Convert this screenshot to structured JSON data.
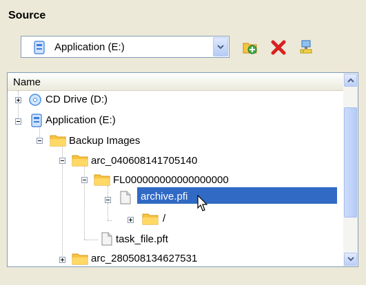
{
  "section": {
    "title": "Source"
  },
  "source_select": {
    "value": "Application (E:)"
  },
  "toolbar": {
    "add_icon": "folder-add-icon",
    "delete_icon": "delete-x-icon",
    "network_icon": "network-computer-icon"
  },
  "tree": {
    "column_header": "Name",
    "nodes": [
      {
        "label": "CD Drive (D:)",
        "icon": "cd-drive-icon"
      },
      {
        "label": "Application (E:)",
        "icon": "drive-icon"
      },
      {
        "label": "Backup Images",
        "icon": "folder-icon"
      },
      {
        "label": "arc_040608141705140",
        "icon": "folder-icon"
      },
      {
        "label": "FL000000000000000000",
        "icon": "folder-icon"
      },
      {
        "label": "archive.pfi",
        "icon": "file-icon",
        "selected": true
      },
      {
        "label": "/",
        "icon": "folder-icon"
      },
      {
        "label": "task_file.pft",
        "icon": "file-icon"
      },
      {
        "label": "arc_280508134627531",
        "icon": "folder-icon"
      }
    ]
  },
  "colors": {
    "selection": "#316ac5",
    "folder": "#f7c442"
  }
}
